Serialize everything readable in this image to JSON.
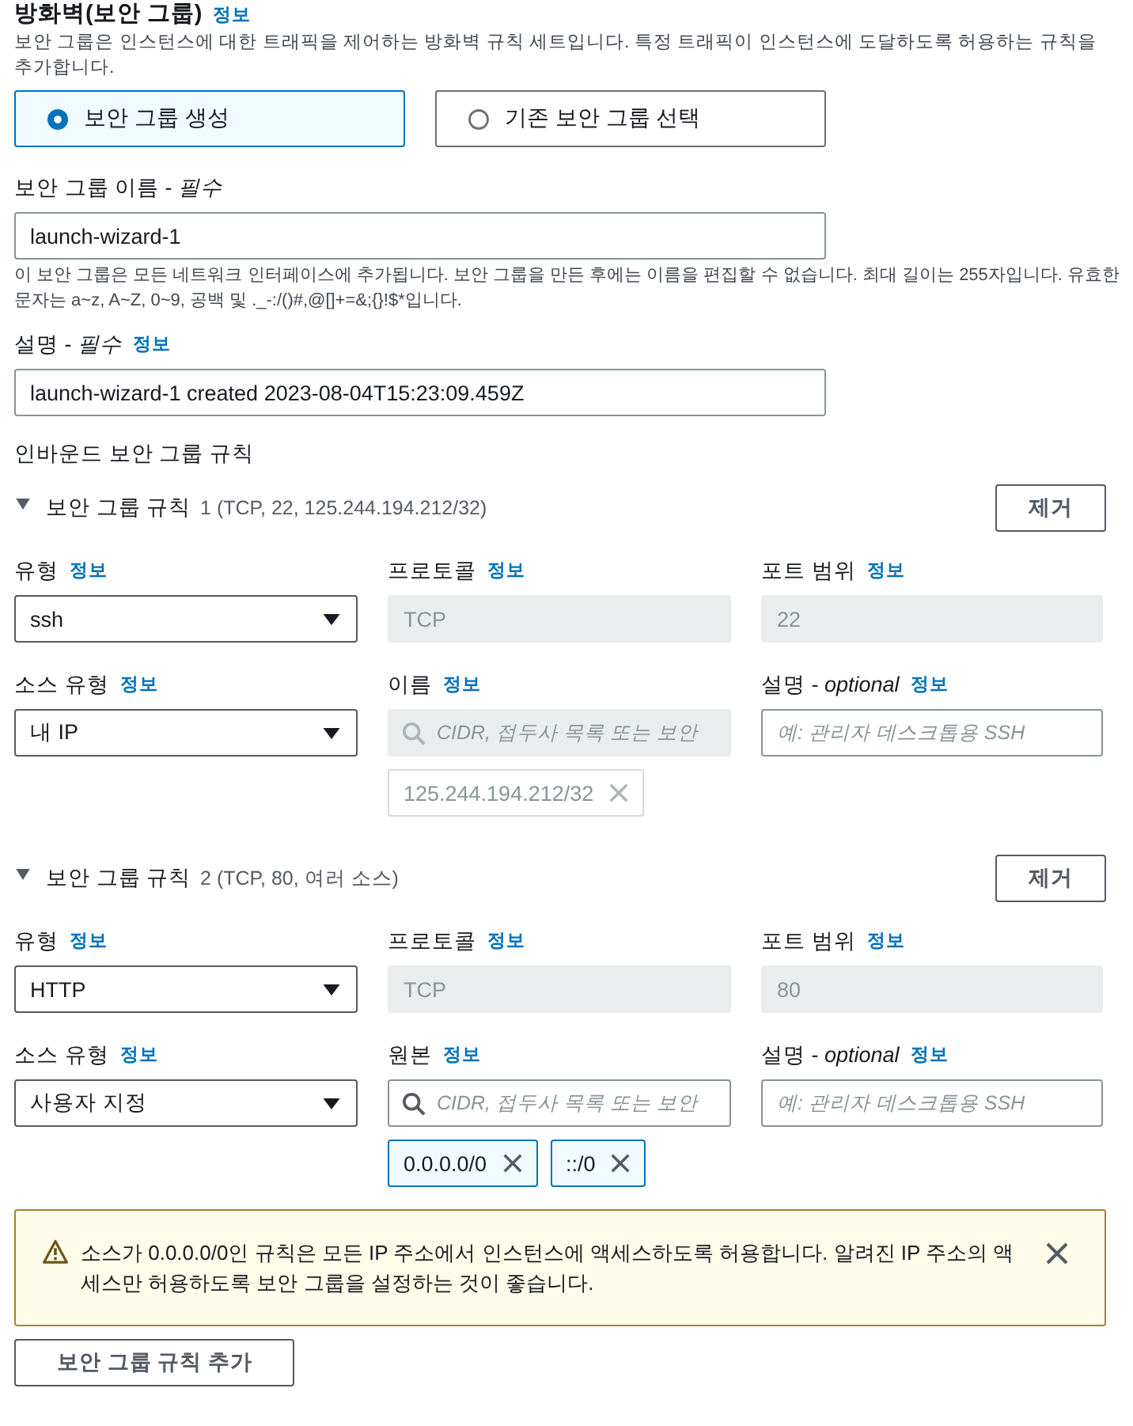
{
  "firewall": {
    "title": "방화벽(보안 그룹)",
    "info": "정보",
    "description": "보안 그룹은 인스턴스에 대한 트래픽을 제어하는 방화벽 규칙 세트입니다. 특정 트래픽이 인스턴스에 도달하도록 허용하는 규칙을 추가합니다."
  },
  "group_mode": [
    {
      "label": "보안 그룹 생성",
      "selected": true
    },
    {
      "label": "기존 보안 그룹 선택",
      "selected": false
    }
  ],
  "group_name": {
    "label": "보안 그룹 이름 - *필수*",
    "value": "launch-wizard-1",
    "help": "이 보안 그룹은 모든 네트워크 인터페이스에 추가됩니다. 보안 그룹을 만든 후에는 이름을 편집할 수 없습니다. 최대 길이는 255자입니다. 유효한 문자는 a~z, A~Z, 0~9, 공백 및 ._-:/()#,@[]+=&;{}!$*입니다."
  },
  "group_description": {
    "label": "설명 - *필수*",
    "info": "정보",
    "value": "launch-wizard-1 created 2023-08-04T15:23:09.459Z"
  },
  "inbound_rules": {
    "title": "인바운드 보안 그룹 규칙",
    "rules": [
      {
        "title": "보안 그룹 규칙",
        "summary": "1 (TCP, 22, 125.244.194.212/32)",
        "expanded": true,
        "remove": "제거",
        "fields": [
          {
            "kind": "select",
            "label": "유형",
            "info": "정보",
            "value": "ssh"
          },
          {
            "kind": "text",
            "label": "프로토콜",
            "info": "정보",
            "value": "TCP",
            "disabled": true
          },
          {
            "kind": "text",
            "label": "포트 범위",
            "info": "정보",
            "value": "22",
            "disabled": true
          },
          {
            "kind": "select",
            "label": "소스 유형",
            "info": "정보",
            "value": "내 IP"
          },
          {
            "kind": "search",
            "label": "이름",
            "info": "정보",
            "placeholder": "CIDR, 접두사 목록 또는 보안",
            "disabled": true,
            "tokens": [
              {
                "value": "125.244.194.212/32",
                "disabled": true
              }
            ]
          },
          {
            "kind": "text",
            "label": "설명 - *optional*",
            "info": "정보",
            "placeholder": "예: 관리자 데스크톱용 SSH",
            "disabled": false
          }
        ]
      },
      {
        "title": "보안 그룹 규칙",
        "summary": "2 (TCP, 80, 여러 소스)",
        "expanded": true,
        "remove": "제거",
        "fields": [
          {
            "kind": "select",
            "label": "유형",
            "info": "정보",
            "value": "HTTP"
          },
          {
            "kind": "text",
            "label": "프로토콜",
            "info": "정보",
            "value": "TCP",
            "disabled": true
          },
          {
            "kind": "text",
            "label": "포트 범위",
            "info": "정보",
            "value": "80",
            "disabled": true
          },
          {
            "kind": "select",
            "label": "소스 유형",
            "info": "정보",
            "value": "사용자 지정"
          },
          {
            "kind": "search",
            "label": "원본",
            "info": "정보",
            "placeholder": "CIDR, 접두사 목록 또는 보안",
            "disabled": false,
            "tokens": [
              {
                "value": "0.0.0.0/0",
                "disabled": false
              },
              {
                "value": "::/0",
                "disabled": false
              }
            ]
          },
          {
            "kind": "text",
            "label": "설명 - *optional*",
            "info": "정보",
            "placeholder": "예: 관리자 데스크톱용 SSH",
            "disabled": false
          }
        ]
      }
    ],
    "alert": {
      "kind": "warning",
      "message": "소스가 0.0.0.0/0인 규칙은 모든 IP 주소에서 인스턴스에 액세스하도록 허용합니다. 알려진 IP 주소의 액세스만 허용하도록 보안 그룹을 설정하는 것이 좋습니다."
    },
    "add_button": "보안 그룹 규칙 추가"
  }
}
